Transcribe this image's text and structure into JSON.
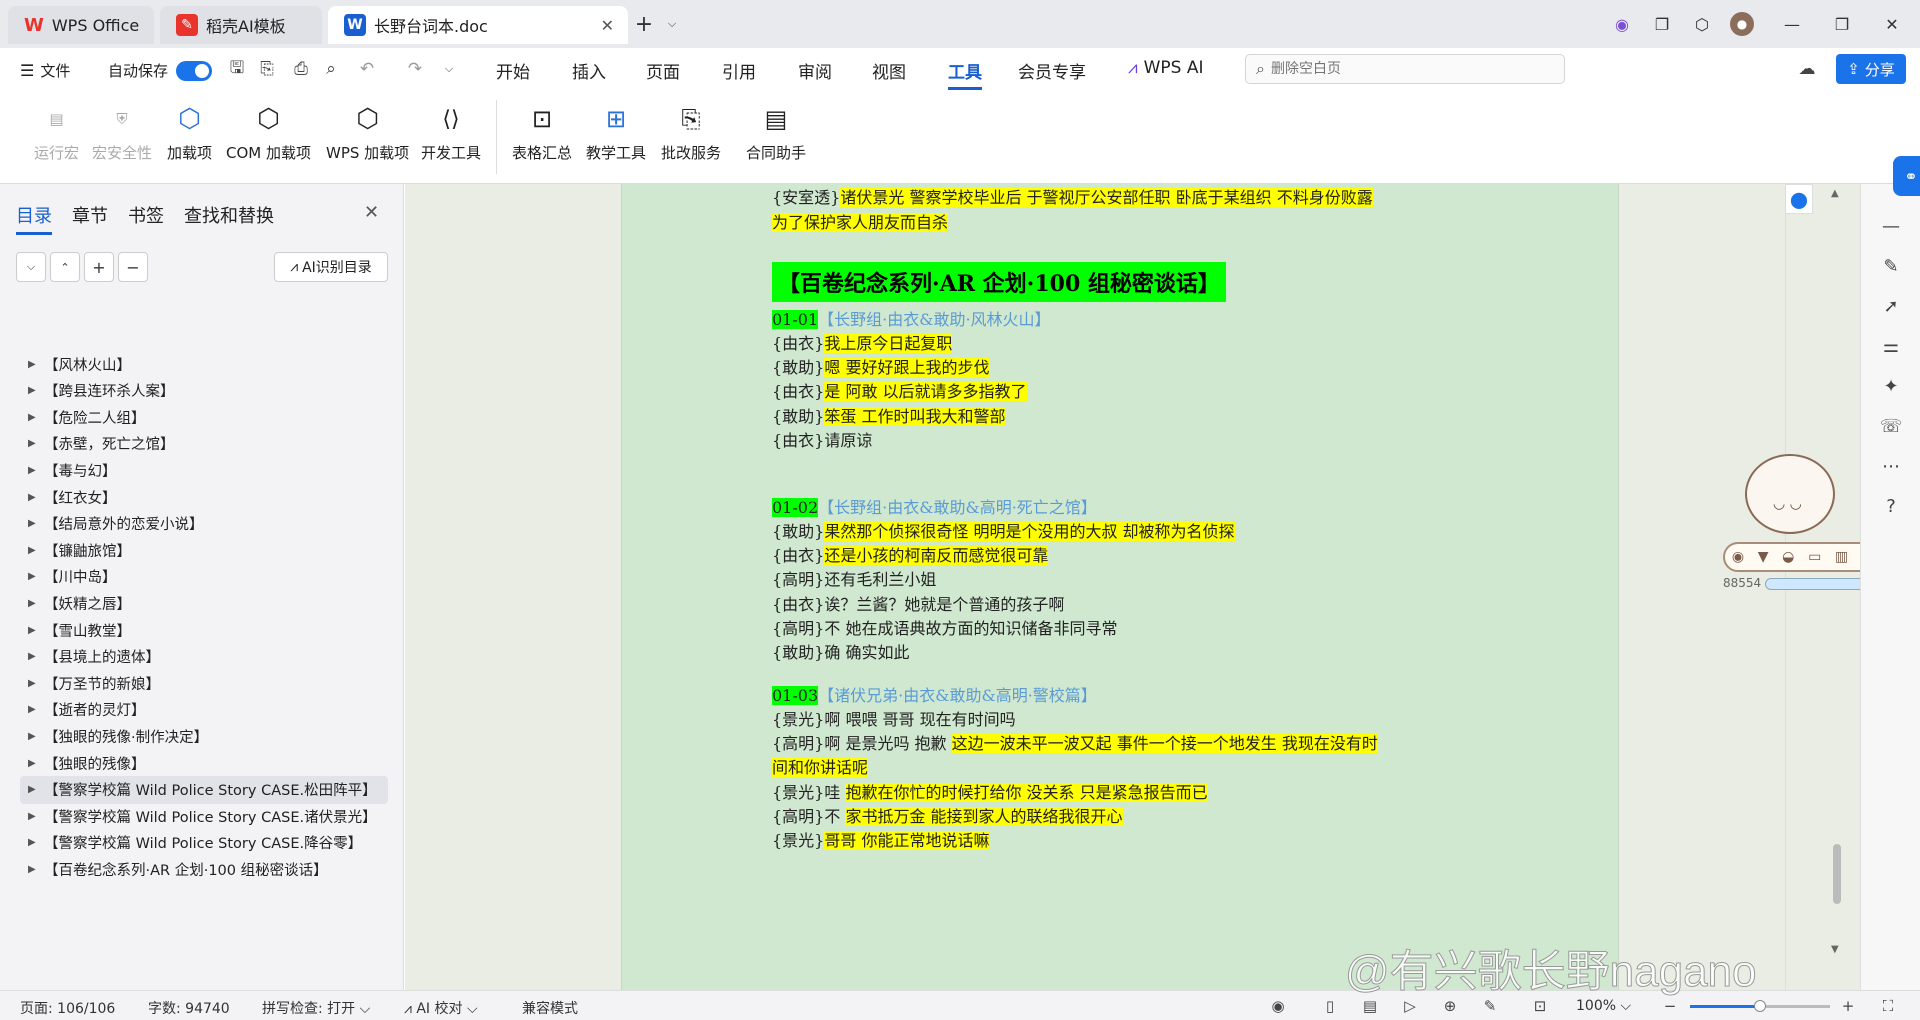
{
  "titlebar": {
    "tabs": [
      {
        "label": "WPS Office",
        "icon": "wps-logo-icon"
      },
      {
        "label": "稻壳AI模板",
        "icon": "docer-logo-icon"
      },
      {
        "label": "长野台词本.doc",
        "icon": "word-doc-icon"
      }
    ],
    "logo_w": "W"
  },
  "menubar": {
    "file": "文件",
    "autosave": "自动保存",
    "items": [
      "开始",
      "插入",
      "页面",
      "引用",
      "审阅",
      "视图",
      "工具",
      "会员专享",
      "WPS AI"
    ],
    "active": "工具",
    "search_placeholder": "删除空白页",
    "share": "分享"
  },
  "ribbon": {
    "items": [
      "运行宏",
      "宏安全性",
      "加载项",
      "COM 加载项",
      "WPS 加载项",
      "开发工具",
      "表格汇总",
      "教学工具",
      "批改服务",
      "合同助手"
    ]
  },
  "sidebar": {
    "tabs": [
      "目录",
      "章节",
      "书签",
      "查找和替换"
    ],
    "ai_button": "AI识别目录",
    "outline": [
      "【风林火山】",
      "【跨县连环杀人案】",
      "【危险二人组】",
      "【赤壁，死亡之馆】",
      "【毒与幻】",
      "【红衣女】",
      "【结局意外的恋爱小说】",
      "【镰鼬旅馆】",
      "【川中岛】",
      "【妖精之唇】",
      "【雪山教堂】",
      "【县境上的遗体】",
      "【万圣节的新娘】",
      "【逝者的灵灯】",
      "【独眼的残像·制作决定】",
      "【独眼的残像】",
      "【警察学校篇 Wild Police Story CASE.松田阵平】",
      "【警察学校篇 Wild Police Story CASE.诸伏景光】",
      "【警察学校篇 Wild Police Story CASE.降谷零】",
      "【百卷纪念系列·AR 企划·100 组秘密谈话】"
    ],
    "selected_index": 16
  },
  "document": {
    "top_lines": [
      {
        "speaker": "{安室透}",
        "text": "诸伏景光  警察学校毕业后  于警视厅公安部任职  卧底于某组织  不料身份败露"
      },
      {
        "speaker": "",
        "text": "为了保护家人朋友而自杀"
      }
    ],
    "heading": "【百卷纪念系列·AR 企划·100 组秘密谈话】",
    "sections": [
      {
        "num": "01-01",
        "title": "【长野组·由衣&敢助·风林火山】",
        "lines": [
          {
            "speaker": "{由衣}",
            "text": "我上原今日起复职"
          },
          {
            "speaker": "{敢助}",
            "text": "嗯  要好好跟上我的步伐"
          },
          {
            "speaker": "{由衣}",
            "text": "是  阿敢  以后就请多多指教了"
          },
          {
            "speaker": "{敢助}",
            "text": "笨蛋   工作时叫我大和警部"
          },
          {
            "speaker": "{由衣}",
            "text": "请原谅"
          }
        ]
      },
      {
        "num": "01-02",
        "title": "【长野组·由衣&敢助&高明·死亡之馆】",
        "lines": [
          {
            "speaker": "{敢助}",
            "text": "果然那个侦探很奇怪  明明是个没用的大叔  却被称为名侦探"
          },
          {
            "speaker": "{由衣}",
            "text": "还是小孩的柯南反而感觉很可靠"
          },
          {
            "speaker": "{高明}",
            "text": "还有毛利兰小姐"
          },
          {
            "speaker": "{由衣}",
            "text": "诶？兰酱？她就是个普通的孩子啊"
          },
          {
            "speaker": "{高明}",
            "text": "不  她在成语典故方面的知识储备非同寻常"
          },
          {
            "speaker": "{敢助}",
            "text": "确  确实如此"
          }
        ]
      },
      {
        "num": "01-03",
        "title": "【诸伏兄弟·由衣&敢助&高明·警校篇】",
        "lines": [
          {
            "speaker": "{景光}",
            "text": "啊  喂喂  哥哥  现在有时间吗"
          },
          {
            "speaker": "{高明}",
            "pre": "啊  是景光吗  抱歉  ",
            "text": "这边一波未平一波又起  事件一个接一个地发生  我现在没有时"
          },
          {
            "speaker": "",
            "text": "间和你讲话呢"
          },
          {
            "speaker": "{景光}",
            "pre": "哇  ",
            "text": "抱歉在你忙的时候打给你  没关系  只是紧急报告而已"
          },
          {
            "speaker": "{高明}",
            "pre": "不  ",
            "text": "家书抵万金  能接到家人的联络我很开心"
          },
          {
            "speaker": "{景光}",
            "text": "哥哥  你能正常地说话嘛"
          }
        ]
      }
    ]
  },
  "pet": {
    "score": "88554"
  },
  "statusbar": {
    "page": "页面: 106/106",
    "words": "字数: 94740",
    "spell": "拼写检查: 打开",
    "ai_check": "AI 校对",
    "compat": "兼容模式",
    "zoom": "100%"
  },
  "watermark": "@有兴歌长野nagano",
  "colors": {
    "accent": "#1a73e8",
    "highlight_yellow": "#ffff00",
    "highlight_green": "#00ff00",
    "page_bg": "#cfe8cf",
    "section_title": "#5b9bd5"
  }
}
